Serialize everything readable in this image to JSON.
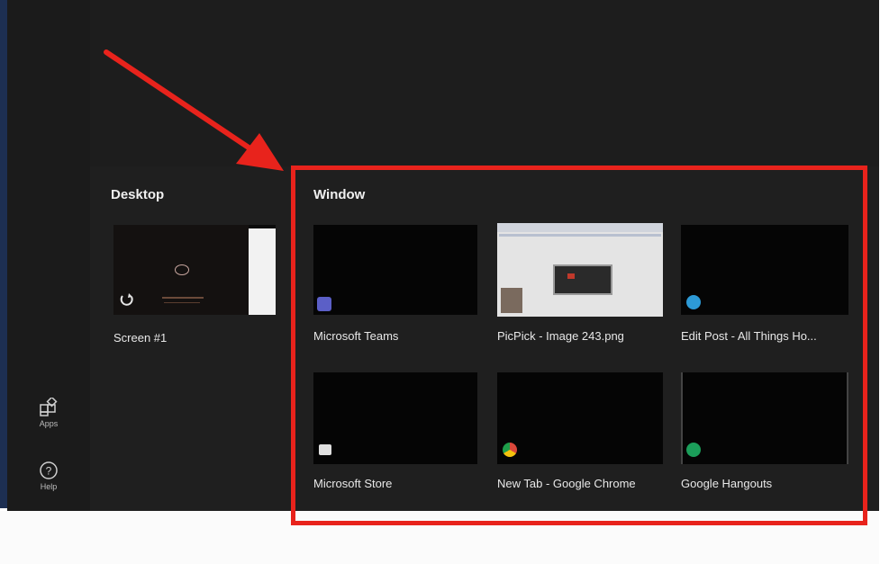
{
  "rail": {
    "apps_label": "Apps",
    "help_label": "Help"
  },
  "desktop": {
    "title": "Desktop",
    "screens": [
      {
        "label": "Screen #1"
      }
    ]
  },
  "window": {
    "title": "Window",
    "items": [
      {
        "label": "Microsoft Teams",
        "icon": "teams-icon",
        "badge_color": "#5b5fc7"
      },
      {
        "label": "PicPick - Image 243.png",
        "icon": "picpick-icon",
        "badge_color": "#7a6a5e"
      },
      {
        "label": "Edit Post - All Things Ho...",
        "icon": "edge-icon",
        "badge_color": "#2d9ad6"
      },
      {
        "label": "Microsoft Store",
        "icon": "store-icon",
        "badge_color": "#e0e0e0"
      },
      {
        "label": "New Tab - Google Chrome",
        "icon": "chrome-icon",
        "badge_color": "#d9473a"
      },
      {
        "label": "Google Hangouts",
        "icon": "hangouts-icon",
        "badge_color": "#1b9e5a"
      }
    ]
  },
  "colors": {
    "annotation": "#e8231c",
    "panel_bg": "#1f1f1f",
    "rail_bg": "#1b1b1b"
  }
}
